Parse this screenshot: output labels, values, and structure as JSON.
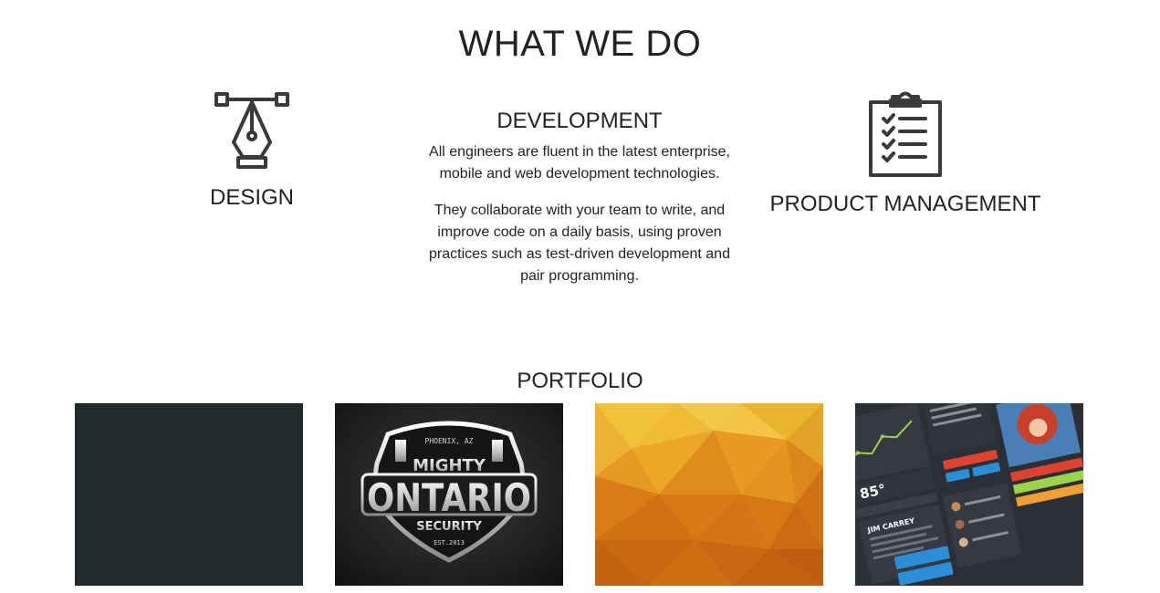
{
  "what_we_do": {
    "title": "WHAT WE DO",
    "services": {
      "design": {
        "icon": "pen-tool-icon",
        "title": "DESIGN"
      },
      "development": {
        "title": "DEVELOPMENT",
        "paragraph_1": "All engineers are fluent in the latest enterprise, mobile and web development technologies.",
        "paragraph_2": "They collaborate with your team to write, and improve code on a daily basis, using proven practices such as test-driven development and pair programming."
      },
      "product_management": {
        "icon": "clipboard-checklist-icon",
        "title": "PRODUCT MANAGEMENT"
      }
    }
  },
  "portfolio": {
    "title": "PORTFOLIO",
    "items": [
      {
        "kind": "dark-placeholder",
        "color": "#222a2e"
      },
      {
        "kind": "logo-badge",
        "badge_top": "PHOENIX, AZ",
        "badge_line1": "MIGHTY",
        "badge_line2": "ONTARIO",
        "badge_line3": "SECURITY",
        "badge_bottom": "EST.2013"
      },
      {
        "kind": "low-poly-orange"
      },
      {
        "kind": "ui-kit-dashboard",
        "temperature": "85°",
        "profile_name": "JIM CARREY"
      }
    ]
  }
}
